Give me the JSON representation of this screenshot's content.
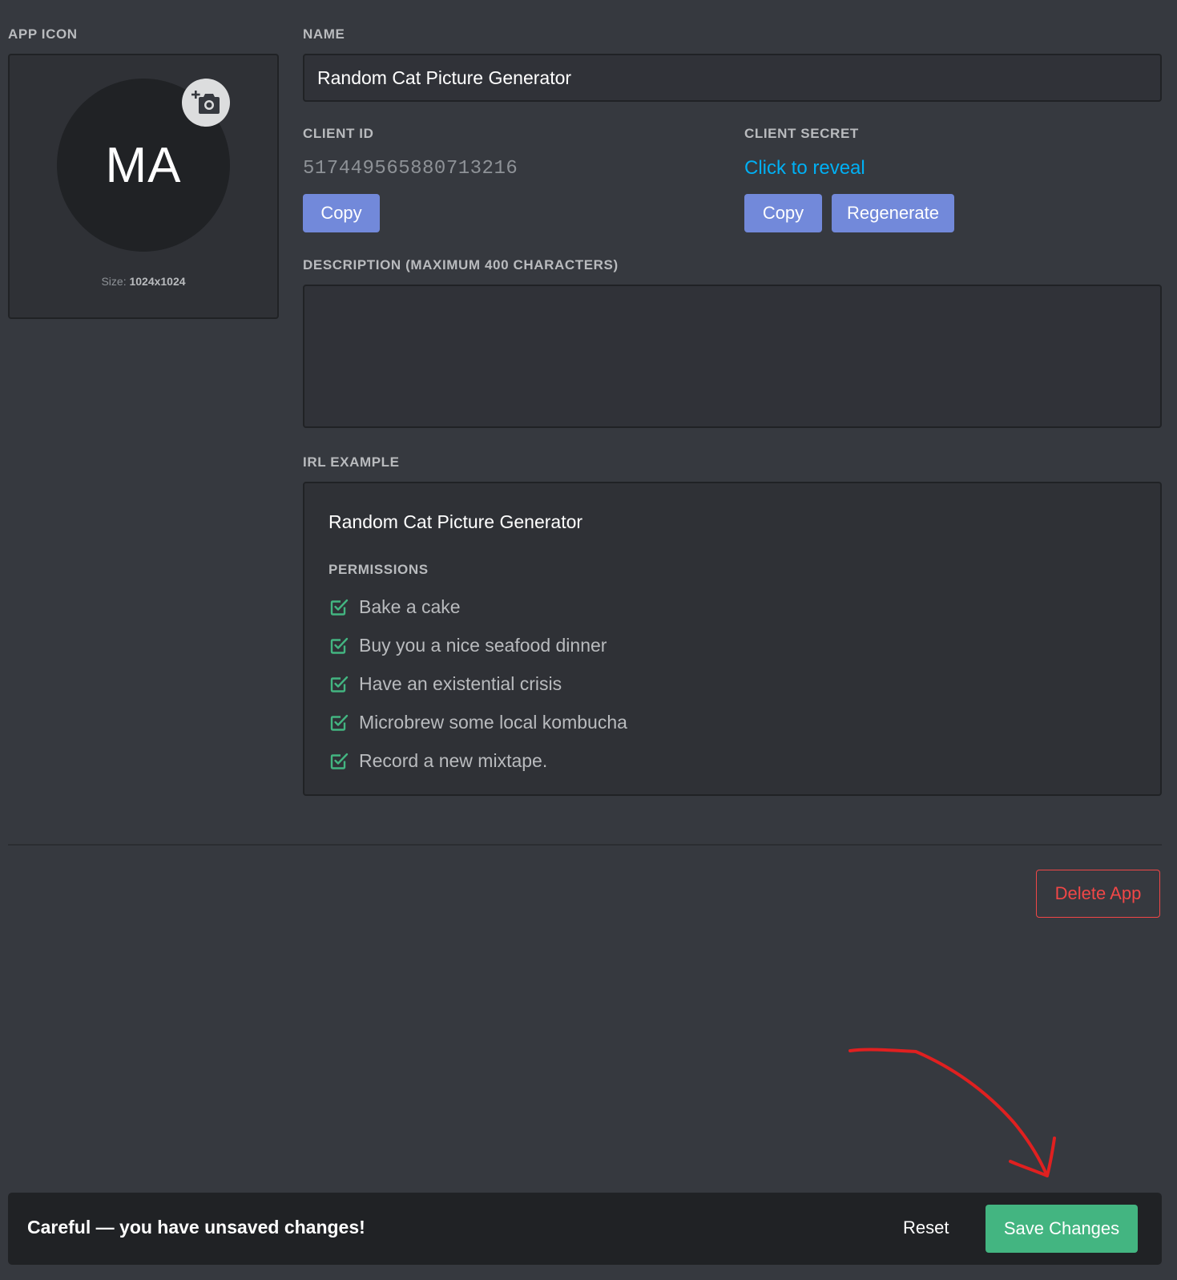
{
  "icon_section": {
    "label": "APP ICON",
    "initials": "MA",
    "size_prefix": "Size:",
    "size_value": "1024x1024",
    "camera_icon": "add-photo-icon"
  },
  "name_section": {
    "label": "NAME",
    "value": "Random Cat Picture Generator"
  },
  "client_id": {
    "label": "CLIENT ID",
    "value": "517449565880713216",
    "copy_label": "Copy"
  },
  "client_secret": {
    "label": "CLIENT SECRET",
    "reveal_text": "Click to reveal",
    "copy_label": "Copy",
    "regenerate_label": "Regenerate"
  },
  "description": {
    "label": "DESCRIPTION (MAXIMUM 400 CHARACTERS)",
    "value": ""
  },
  "irl_example": {
    "label": "IRL EXAMPLE",
    "app_name": "Random Cat Picture Generator",
    "permissions_label": "PERMISSIONS",
    "permissions": [
      "Bake a cake",
      "Buy you a nice seafood dinner",
      "Have an existential crisis",
      "Microbrew some local kombucha",
      "Record a new mixtape."
    ],
    "check_icon": "checkbox-checked-icon"
  },
  "danger": {
    "delete_label": "Delete App"
  },
  "notice_bar": {
    "message": "Careful — you have unsaved changes!",
    "reset_label": "Reset",
    "save_label": "Save Changes"
  },
  "colors": {
    "background": "#36393f",
    "blurple": "#7289da",
    "link": "#00b0f4",
    "success": "#43b581",
    "danger": "#f04747",
    "annotation": "#e02020",
    "check": "#43b581"
  }
}
